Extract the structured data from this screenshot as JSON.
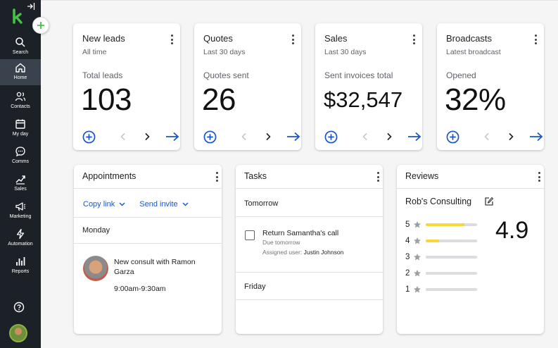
{
  "sidebar": {
    "items": [
      {
        "label": "Search",
        "icon": "search-icon"
      },
      {
        "label": "Home",
        "icon": "home-icon",
        "active": true
      },
      {
        "label": "Contacts",
        "icon": "contacts-icon"
      },
      {
        "label": "My day",
        "icon": "calendar-icon"
      },
      {
        "label": "Comms",
        "icon": "chat-icon"
      },
      {
        "label": "Sales",
        "icon": "sales-icon"
      },
      {
        "label": "Marketing",
        "icon": "megaphone-icon"
      },
      {
        "label": "Automation",
        "icon": "lightning-icon"
      },
      {
        "label": "Reports",
        "icon": "bar-chart-icon"
      }
    ]
  },
  "cards": [
    {
      "title": "New leads",
      "subtitle": "All time",
      "metric_label": "Total leads",
      "value": "103"
    },
    {
      "title": "Quotes",
      "subtitle": "Last 30 days",
      "metric_label": "Quotes sent",
      "value": "26"
    },
    {
      "title": "Sales",
      "subtitle": "Last 30 days",
      "metric_label": "Sent invoices total",
      "value": "$32,547"
    },
    {
      "title": "Broadcasts",
      "subtitle": "Latest broadcast",
      "metric_label": "Opened",
      "value": "32%"
    }
  ],
  "appointments": {
    "title": "Appointments",
    "copy_link": "Copy link",
    "send_invite": "Send invite",
    "day": "Monday",
    "item_title": "New consult with Ramon Garza",
    "item_time": "9:00am-9:30am"
  },
  "tasks": {
    "title": "Tasks",
    "section1": "Tomorrow",
    "task_title": "Return Samantha's call",
    "task_due": "Due tomorrow",
    "task_user_label": "Assigned user:",
    "task_user": "Justin Johnson",
    "section2": "Friday"
  },
  "reviews": {
    "title": "Reviews",
    "business": "Rob's Consulting",
    "score": "4.9",
    "ratings": [
      {
        "stars": "5",
        "fraction": 0.75
      },
      {
        "stars": "4",
        "fraction": 0.26
      },
      {
        "stars": "3",
        "fraction": 0
      },
      {
        "stars": "2",
        "fraction": 0
      },
      {
        "stars": "1",
        "fraction": 0
      }
    ]
  },
  "colors": {
    "sidebar": "#1c2128",
    "sidebar_active": "#39424d",
    "brand_green": "#45c148",
    "accent_blue": "#1a56c4",
    "star_yellow": "#f9d536"
  }
}
